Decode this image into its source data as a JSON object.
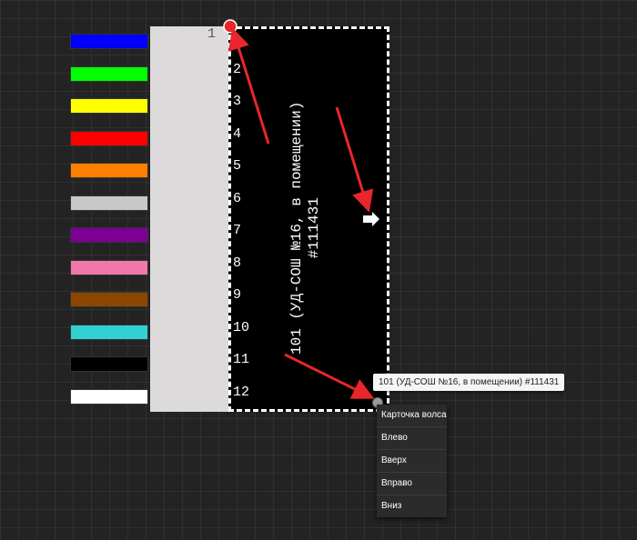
{
  "palette": {
    "colors": [
      "#0000ff",
      "#00ff00",
      "#ffff00",
      "#ff0000",
      "#ff8000",
      "#c8c8c8",
      "#7d0096",
      "#f078aa",
      "#8c4600",
      "#32d2d2",
      "#000000",
      "#ffffff"
    ]
  },
  "ruler": {
    "first_label": "1"
  },
  "panel": {
    "row_numbers": [
      "2",
      "3",
      "4",
      "5",
      "6",
      "7",
      "8",
      "9",
      "10",
      "11",
      "12"
    ],
    "vertical_text": {
      "line1": "101 (УД-СОШ №16, в помещении)",
      "line2": "#111431"
    }
  },
  "tooltip": {
    "text": "101 (УД-СОШ №16, в помещении) #111431"
  },
  "context_menu": {
    "items": [
      "Карточка волса",
      "Влево",
      "Вверх",
      "Вправо",
      "Вниз"
    ]
  }
}
